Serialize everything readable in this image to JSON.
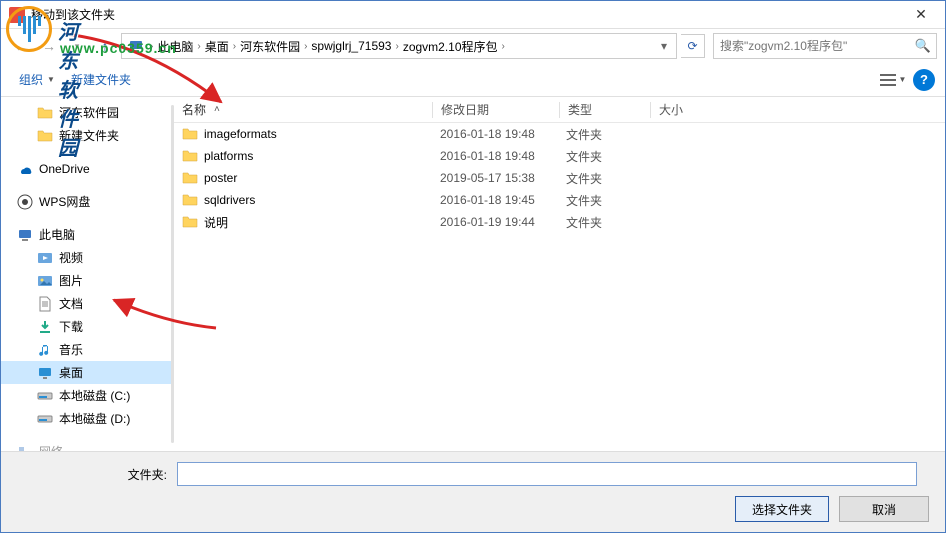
{
  "window": {
    "title": "移动到该文件夹"
  },
  "watermark": {
    "text": "河东软件园",
    "url": "www.pc0359.cn"
  },
  "nav": {
    "refresh_visible": true
  },
  "breadcrumb": [
    "此电脑",
    "桌面",
    "河东软件园",
    "spwjglrj_71593",
    "zogvm2.10程序包"
  ],
  "search": {
    "placeholder": "搜索\"zogvm2.10程序包\""
  },
  "toolbar": {
    "organize": "组织",
    "newfolder": "新建文件夹"
  },
  "columns": {
    "name": "名称",
    "modified": "修改日期",
    "type": "类型",
    "size": "大小"
  },
  "sidebar": {
    "items_top": [
      {
        "label": "河东软件园",
        "icon": "folder"
      },
      {
        "label": "新建文件夹",
        "icon": "folder"
      }
    ],
    "onedrive": "OneDrive",
    "wps": "WPS网盘",
    "pc": "此电脑",
    "pc_children": [
      {
        "label": "视频",
        "icon": "video"
      },
      {
        "label": "图片",
        "icon": "picture"
      },
      {
        "label": "文档",
        "icon": "doc"
      },
      {
        "label": "下载",
        "icon": "download"
      },
      {
        "label": "音乐",
        "icon": "music"
      },
      {
        "label": "桌面",
        "icon": "desktop",
        "selected": true
      },
      {
        "label": "本地磁盘 (C:)",
        "icon": "drive"
      },
      {
        "label": "本地磁盘 (D:)",
        "icon": "drive"
      }
    ],
    "network": "网络"
  },
  "files": [
    {
      "name": "imageformats",
      "date": "2016-01-18 19:48",
      "type": "文件夹"
    },
    {
      "name": "platforms",
      "date": "2016-01-18 19:48",
      "type": "文件夹"
    },
    {
      "name": "poster",
      "date": "2019-05-17 15:38",
      "type": "文件夹"
    },
    {
      "name": "sqldrivers",
      "date": "2016-01-18 19:45",
      "type": "文件夹"
    },
    {
      "name": "说明",
      "date": "2016-01-19 19:44",
      "type": "文件夹"
    }
  ],
  "footer": {
    "folder_label": "文件夹:",
    "folder_value": "",
    "select_btn": "选择文件夹",
    "cancel_btn": "取消"
  }
}
